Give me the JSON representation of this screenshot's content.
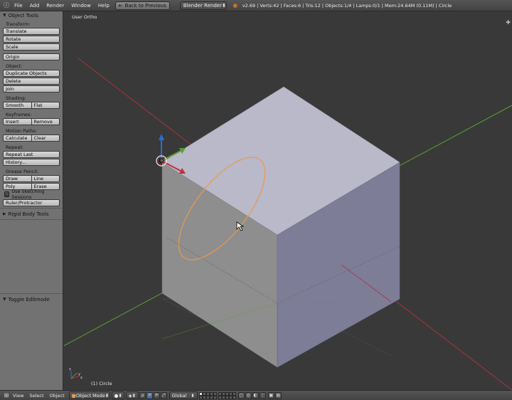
{
  "header": {
    "menus": [
      "File",
      "Add",
      "Render",
      "Window",
      "Help"
    ],
    "back_button": "Back to Previous",
    "render_engine": "Blender Render",
    "stats": "v2.69 | Verts:42 | Faces:6 | Tris:12 | Objects:1/4 | Lamps:0/1 | Mem:24.64M (0.11M) | Circle"
  },
  "toolshelf": {
    "title": "Object Tools",
    "transform_label": "Transform:",
    "translate": "Translate",
    "rotate": "Rotate",
    "scale": "Scale",
    "origin": "Origin",
    "object_label": "Object:",
    "duplicate": "Duplicate Objects",
    "delete": "Delete",
    "join": "Join",
    "shading_label": "Shading:",
    "smooth": "Smooth",
    "flat": "Flat",
    "keyframes_label": "Keyframes:",
    "insert": "Insert",
    "remove": "Remove",
    "motion_path_label": "Motion Paths:",
    "calculate": "Calculate",
    "clear": "Clear",
    "repeat_label": "Repeat:",
    "repeat_last": "Repeat Last",
    "history": "History...",
    "grease_label": "Grease Pencil:",
    "draw": "Draw",
    "line": "Line",
    "poly": "Poly",
    "erase": "Erase",
    "sketching": "Use Sketching Sessions",
    "ruler": "Ruler/Protractor",
    "rigid_body": "Rigid Body Tools",
    "toggle_editmode": "Toggle Editmode"
  },
  "viewport": {
    "view_name": "User Ortho",
    "active_object": "(1) Circle"
  },
  "footer": {
    "menus": [
      "View",
      "Select",
      "Object"
    ],
    "mode": "Object Mode",
    "orientation": "Global"
  },
  "colors": {
    "cube_top": "#b9b9c9",
    "cube_left": "#8e8e8e",
    "cube_right": "#7d7d98",
    "circle": "#e89a4a",
    "x_axis": "#a8343c",
    "y_axis": "#5aa030",
    "z_axis": "#2a6bd8"
  }
}
